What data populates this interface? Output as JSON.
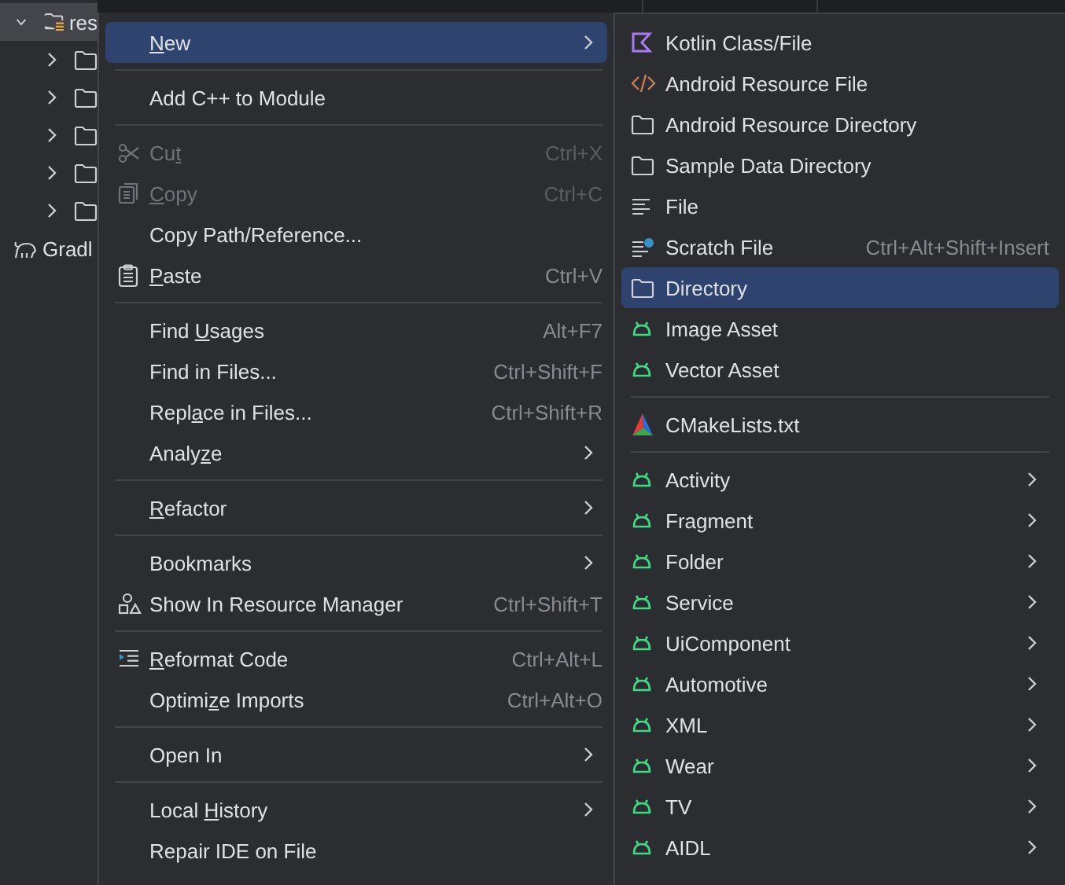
{
  "project_tree": [
    {
      "label": "res",
      "kind": "resources",
      "expanded": true,
      "selected": true,
      "children": [
        {
          "kind": "folder",
          "expanded": false
        },
        {
          "kind": "folder",
          "expanded": false
        },
        {
          "kind": "folder",
          "expanded": false
        },
        {
          "kind": "folder",
          "expanded": false
        },
        {
          "kind": "folder",
          "expanded": false
        }
      ]
    },
    {
      "label": "Gradl",
      "kind": "gradle"
    }
  ],
  "context_menu": {
    "items": [
      {
        "kind": "plain",
        "segments": [
          {
            "text": "N",
            "mnemonic": true
          },
          {
            "text": "ew",
            "mnemonic": false
          }
        ],
        "selected": true,
        "disabled": false,
        "submenu": true
      },
      {
        "kind": "separator"
      },
      {
        "kind": "plain",
        "segments": [
          {
            "text": "Add C++ to Module",
            "mnemonic": false
          }
        ],
        "selected": false,
        "disabled": false,
        "submenu": false
      },
      {
        "kind": "separator"
      },
      {
        "kind": "cut",
        "segments": [
          {
            "text": "Cu",
            "mnemonic": false
          },
          {
            "text": "t",
            "mnemonic": true
          }
        ],
        "shortcut": "Ctrl+X",
        "selected": false,
        "disabled": true,
        "submenu": false
      },
      {
        "kind": "copy",
        "segments": [
          {
            "text": "C",
            "mnemonic": true
          },
          {
            "text": "opy",
            "mnemonic": false
          }
        ],
        "shortcut": "Ctrl+C",
        "selected": false,
        "disabled": true,
        "submenu": false
      },
      {
        "kind": "plain",
        "segments": [
          {
            "text": "Copy Path/Reference...",
            "mnemonic": false
          }
        ],
        "selected": false,
        "disabled": false,
        "submenu": false
      },
      {
        "kind": "paste",
        "segments": [
          {
            "text": "P",
            "mnemonic": true
          },
          {
            "text": "aste",
            "mnemonic": false
          }
        ],
        "shortcut": "Ctrl+V",
        "selected": false,
        "disabled": false,
        "submenu": false
      },
      {
        "kind": "separator"
      },
      {
        "kind": "plain",
        "segments": [
          {
            "text": "Find ",
            "mnemonic": false
          },
          {
            "text": "U",
            "mnemonic": true
          },
          {
            "text": "sages",
            "mnemonic": false
          }
        ],
        "shortcut": "Alt+F7",
        "selected": false,
        "disabled": false,
        "submenu": false
      },
      {
        "kind": "plain",
        "segments": [
          {
            "text": "Find in Files...",
            "mnemonic": false
          }
        ],
        "shortcut": "Ctrl+Shift+F",
        "selected": false,
        "disabled": false,
        "submenu": false
      },
      {
        "kind": "plain",
        "segments": [
          {
            "text": "Repl",
            "mnemonic": false
          },
          {
            "text": "a",
            "mnemonic": true
          },
          {
            "text": "ce in Files...",
            "mnemonic": false
          }
        ],
        "shortcut": "Ctrl+Shift+R",
        "selected": false,
        "disabled": false,
        "submenu": false
      },
      {
        "kind": "plain",
        "segments": [
          {
            "text": "Analy",
            "mnemonic": false
          },
          {
            "text": "z",
            "mnemonic": true
          },
          {
            "text": "e",
            "mnemonic": false
          }
        ],
        "selected": false,
        "disabled": false,
        "submenu": true
      },
      {
        "kind": "separator"
      },
      {
        "kind": "plain",
        "segments": [
          {
            "text": "R",
            "mnemonic": true
          },
          {
            "text": "efactor",
            "mnemonic": false
          }
        ],
        "selected": false,
        "disabled": false,
        "submenu": true
      },
      {
        "kind": "separator"
      },
      {
        "kind": "plain",
        "segments": [
          {
            "text": "Bookmarks",
            "mnemonic": false
          }
        ],
        "selected": false,
        "disabled": false,
        "submenu": true
      },
      {
        "kind": "resource",
        "segments": [
          {
            "text": "Show In Resource Manager",
            "mnemonic": false
          }
        ],
        "shortcut": "Ctrl+Shift+T",
        "selected": false,
        "disabled": false,
        "submenu": false
      },
      {
        "kind": "separator"
      },
      {
        "kind": "reformat",
        "segments": [
          {
            "text": "R",
            "mnemonic": true
          },
          {
            "text": "eformat Code",
            "mnemonic": false
          }
        ],
        "shortcut": "Ctrl+Alt+L",
        "selected": false,
        "disabled": false,
        "submenu": false
      },
      {
        "kind": "plain",
        "segments": [
          {
            "text": "Optimi",
            "mnemonic": false
          },
          {
            "text": "z",
            "mnemonic": true
          },
          {
            "text": "e Imports",
            "mnemonic": false
          }
        ],
        "shortcut": "Ctrl+Alt+O",
        "selected": false,
        "disabled": false,
        "submenu": false
      },
      {
        "kind": "separator"
      },
      {
        "kind": "plain",
        "segments": [
          {
            "text": "Open In",
            "mnemonic": false
          }
        ],
        "selected": false,
        "disabled": false,
        "submenu": true
      },
      {
        "kind": "separator"
      },
      {
        "kind": "plain",
        "segments": [
          {
            "text": "Local ",
            "mnemonic": false
          },
          {
            "text": "H",
            "mnemonic": true
          },
          {
            "text": "istory",
            "mnemonic": false
          }
        ],
        "selected": false,
        "disabled": false,
        "submenu": true
      },
      {
        "kind": "plain",
        "segments": [
          {
            "text": "Repair IDE on File",
            "mnemonic": false
          }
        ],
        "selected": false,
        "disabled": false,
        "submenu": false
      }
    ]
  },
  "new_submenu": {
    "items": [
      {
        "kind": "kotlin",
        "segments": [
          {
            "text": "Kotlin Class/File",
            "mnemonic": false
          }
        ],
        "selected": false,
        "submenu": false
      },
      {
        "kind": "xml",
        "segments": [
          {
            "text": "Android Resource File",
            "mnemonic": false
          }
        ],
        "selected": false,
        "submenu": false
      },
      {
        "kind": "folder",
        "segments": [
          {
            "text": "Android Resource Directory",
            "mnemonic": false
          }
        ],
        "selected": false,
        "submenu": false
      },
      {
        "kind": "folder",
        "segments": [
          {
            "text": "Sample Data Directory",
            "mnemonic": false
          }
        ],
        "selected": false,
        "submenu": false
      },
      {
        "kind": "file",
        "segments": [
          {
            "text": "File",
            "mnemonic": false
          }
        ],
        "selected": false,
        "submenu": false
      },
      {
        "kind": "scratch",
        "segments": [
          {
            "text": "Scratch File",
            "mnemonic": false
          }
        ],
        "shortcut": "Ctrl+Alt+Shift+Insert",
        "selected": false,
        "submenu": false
      },
      {
        "kind": "folder",
        "segments": [
          {
            "text": "Directory",
            "mnemonic": false
          }
        ],
        "selected": true,
        "submenu": false
      },
      {
        "kind": "android",
        "segments": [
          {
            "text": "Image Asset",
            "mnemonic": false
          }
        ],
        "selected": false,
        "submenu": false
      },
      {
        "kind": "android",
        "segments": [
          {
            "text": "Vector Asset",
            "mnemonic": false
          }
        ],
        "selected": false,
        "submenu": false
      },
      {
        "kind": "separator"
      },
      {
        "kind": "cmake",
        "segments": [
          {
            "text": "CMakeLists.txt",
            "mnemonic": false
          }
        ],
        "selected": false,
        "submenu": false
      },
      {
        "kind": "separator"
      },
      {
        "kind": "android",
        "segments": [
          {
            "text": "Activity",
            "mnemonic": false
          }
        ],
        "selected": false,
        "submenu": true
      },
      {
        "kind": "android",
        "segments": [
          {
            "text": "Fragment",
            "mnemonic": false
          }
        ],
        "selected": false,
        "submenu": true
      },
      {
        "kind": "android",
        "segments": [
          {
            "text": "Folder",
            "mnemonic": false
          }
        ],
        "selected": false,
        "submenu": true
      },
      {
        "kind": "android",
        "segments": [
          {
            "text": "Service",
            "mnemonic": false
          }
        ],
        "selected": false,
        "submenu": true
      },
      {
        "kind": "android",
        "segments": [
          {
            "text": "UiComponent",
            "mnemonic": false
          }
        ],
        "selected": false,
        "submenu": true
      },
      {
        "kind": "android",
        "segments": [
          {
            "text": "Automotive",
            "mnemonic": false
          }
        ],
        "selected": false,
        "submenu": true
      },
      {
        "kind": "android",
        "segments": [
          {
            "text": "XML",
            "mnemonic": false
          }
        ],
        "selected": false,
        "submenu": true
      },
      {
        "kind": "android",
        "segments": [
          {
            "text": "Wear",
            "mnemonic": false
          }
        ],
        "selected": false,
        "submenu": true
      },
      {
        "kind": "android",
        "segments": [
          {
            "text": "TV",
            "mnemonic": false
          }
        ],
        "selected": false,
        "submenu": true
      },
      {
        "kind": "android",
        "segments": [
          {
            "text": "AIDL",
            "mnemonic": false
          }
        ],
        "selected": false,
        "submenu": true
      }
    ]
  }
}
